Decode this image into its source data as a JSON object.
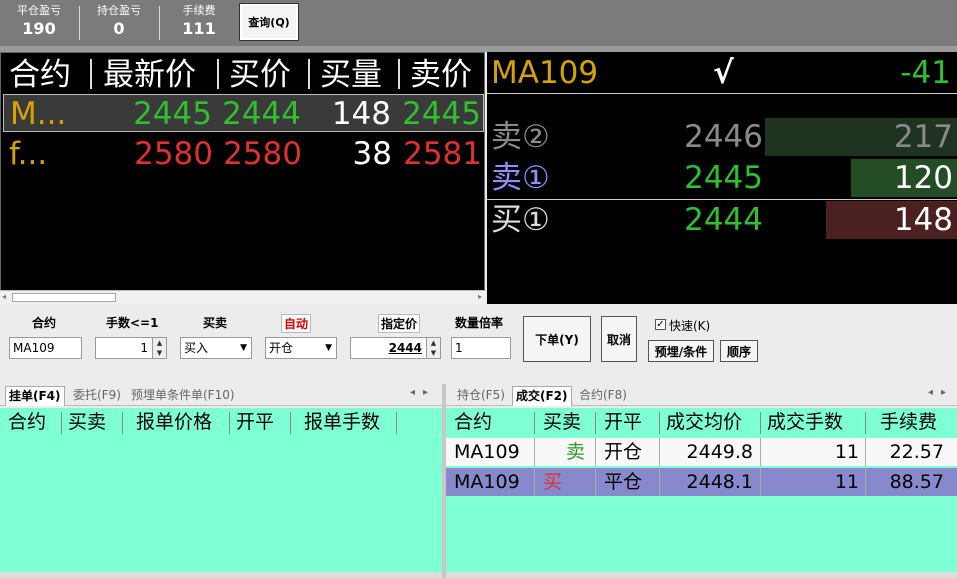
{
  "stats": [
    {
      "label": "平仓盈亏",
      "value": "190"
    },
    {
      "label": "持仓盈亏",
      "value": "0"
    },
    {
      "label": "手续费",
      "value": "111"
    }
  ],
  "query_button": "查询(Q)",
  "quote_table": {
    "headers": [
      "合约",
      "最新价",
      "买价",
      "买量",
      "卖价"
    ],
    "rows": [
      {
        "contract": "M...",
        "last": "2445",
        "bid": "2444",
        "bid_qty": "148",
        "ask": "2445"
      },
      {
        "contract": "f...",
        "last": "2580",
        "bid": "2580",
        "bid_qty": "38",
        "ask": "2581"
      }
    ]
  },
  "depth": {
    "contract": "MA109",
    "check": "√",
    "change": "-41",
    "levels": [
      {
        "label": "卖②",
        "price": "2446",
        "qty": "217",
        "qty_value": 217
      },
      {
        "label": "卖①",
        "price": "2445",
        "qty": "120",
        "qty_value": 120
      },
      {
        "label": "买①",
        "price": "2444",
        "qty": "148",
        "qty_value": 148
      }
    ]
  },
  "order_form": {
    "contract_label": "合约",
    "contract_value": "MA109",
    "qty_label": "手数<=1",
    "qty_value": "1",
    "side_label": "买卖",
    "side_value": "买入",
    "offset_label": "自动",
    "offset_value": "开仓",
    "price_label": "指定价",
    "price_value": "2444",
    "multiplier_label": "数量倍率",
    "multiplier_value": "1",
    "submit_button": "下单(Y)",
    "cancel_button": "取消",
    "quick_label": "快速(K)",
    "quick_checked": "✓",
    "preset_button": "预埋/条件",
    "sequence_button": "顺序"
  },
  "left_panel": {
    "tabs": [
      "挂单(F4)",
      "委托(F9)",
      "预埋单条件单(F10)"
    ],
    "headers": [
      "合约",
      "买卖",
      "报单价格",
      "开平",
      "报单手数"
    ]
  },
  "right_panel": {
    "tabs": [
      "持仓(F5)",
      "成交(F2)",
      "合约(F8)"
    ],
    "headers": [
      "合约",
      "买卖",
      "开平",
      "成交均价",
      "成交手数",
      "手续费"
    ],
    "rows": [
      {
        "contract": "MA109",
        "side": "卖",
        "offset": "开仓",
        "avg_price": "2449.8",
        "qty": "11",
        "fee": "22.57"
      },
      {
        "contract": "MA109",
        "side": "买",
        "offset": "平仓",
        "avg_price": "2448.1",
        "qty": "11",
        "fee": "88.57"
      }
    ]
  },
  "colors": {
    "up": "#e03030",
    "down": "#2fbf2f",
    "contract_gold": "#d4a300",
    "grid_bg": "#7fffd4",
    "selected_row": "#8888cc"
  }
}
